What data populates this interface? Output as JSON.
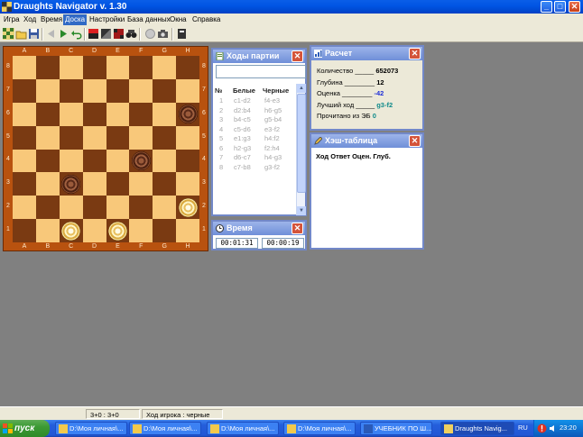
{
  "window": {
    "title": "Draughts Navigator v. 1.30",
    "minimize": "_",
    "maximize": "□",
    "close": "✕"
  },
  "menu": [
    "Игра",
    "Ход",
    "Время",
    "Доска",
    "Настройки",
    "База данных",
    "Окна",
    "Справка"
  ],
  "menu_active": "Доска",
  "toolbar_icons": [
    "board-setup-icon",
    "open-icon",
    "save-icon",
    "back-icon",
    "forward-icon",
    "undo-icon",
    "white-side-icon",
    "black-side-icon",
    "red-board-icon",
    "binoculars-icon",
    "stop-icon",
    "camera-icon",
    "help-book-icon"
  ],
  "board": {
    "files": [
      "A",
      "B",
      "C",
      "D",
      "E",
      "F",
      "G",
      "H"
    ],
    "ranks": [
      "8",
      "7",
      "6",
      "5",
      "4",
      "3",
      "2",
      "1"
    ],
    "colors": {
      "light": "#f8c87a",
      "dark": "#7a3a12",
      "frame": "#b8520f"
    },
    "pieces": [
      {
        "square": "h6",
        "color": "black"
      },
      {
        "square": "f4",
        "color": "black"
      },
      {
        "square": "c3",
        "color": "black"
      },
      {
        "square": "h2",
        "color": "white"
      },
      {
        "square": "c1",
        "color": "white"
      },
      {
        "square": "e1",
        "color": "white"
      }
    ]
  },
  "moves_panel": {
    "title": "Ходы партии",
    "headers": {
      "no": "№",
      "white": "Белые",
      "black": "Черные"
    },
    "rows": [
      {
        "no": "1",
        "white": "c1-d2",
        "black": "f4-e3"
      },
      {
        "no": "2",
        "white": "d2:b4",
        "black": "h6-g5"
      },
      {
        "no": "3",
        "white": "b4-c5",
        "black": "g5-b4"
      },
      {
        "no": "4",
        "white": "c5-d6",
        "black": "e3-f2"
      },
      {
        "no": "5",
        "white": "e1:g3",
        "black": "h4:f2"
      },
      {
        "no": "6",
        "white": "h2-g3",
        "black": "f2:h4"
      },
      {
        "no": "7",
        "white": "d6-c7",
        "black": "h4-g3"
      },
      {
        "no": "8",
        "white": "c7-b8",
        "black": "g3-f2"
      }
    ]
  },
  "time_panel": {
    "title": "Время",
    "white_time": "00:01:31",
    "black_time": "00:00:19"
  },
  "calc_panel": {
    "title": "Расчет",
    "lines": [
      {
        "label": "Количество _____",
        "value": "652073",
        "color": "#000000"
      },
      {
        "label": "Глубина ________",
        "value": "12",
        "color": "#000000"
      },
      {
        "label": "Оценка ________",
        "value": "-42",
        "color": "#1f2fd8"
      },
      {
        "label": "Лучший ход _____",
        "value": "g3-f2",
        "color": "#0f8a8a"
      },
      {
        "label": "Прочитано из ЭБ",
        "value": "0",
        "color": "#0f8a8a"
      }
    ]
  },
  "hash_panel": {
    "title": "Хэш-таблица",
    "columns": "Ход     Ответ  Оцен.  Глуб."
  },
  "status": {
    "score": "3+0 : 3+0",
    "turn": "Ход игрока : черные"
  },
  "taskbar": {
    "start": "пуск",
    "tasks": [
      {
        "label": "D:\\Моя личная\\...",
        "active": false
      },
      {
        "label": "D:\\Моя личная\\...",
        "active": false
      },
      {
        "label": "D:\\Моя личная\\...",
        "active": false
      },
      {
        "label": "D:\\Моя личная\\...",
        "active": false
      },
      {
        "label": "УЧЕБНИК ПО Ш...",
        "active": false
      },
      {
        "label": "Draughts Navig...",
        "active": true
      }
    ],
    "language": "RU",
    "clock": "23:20"
  }
}
